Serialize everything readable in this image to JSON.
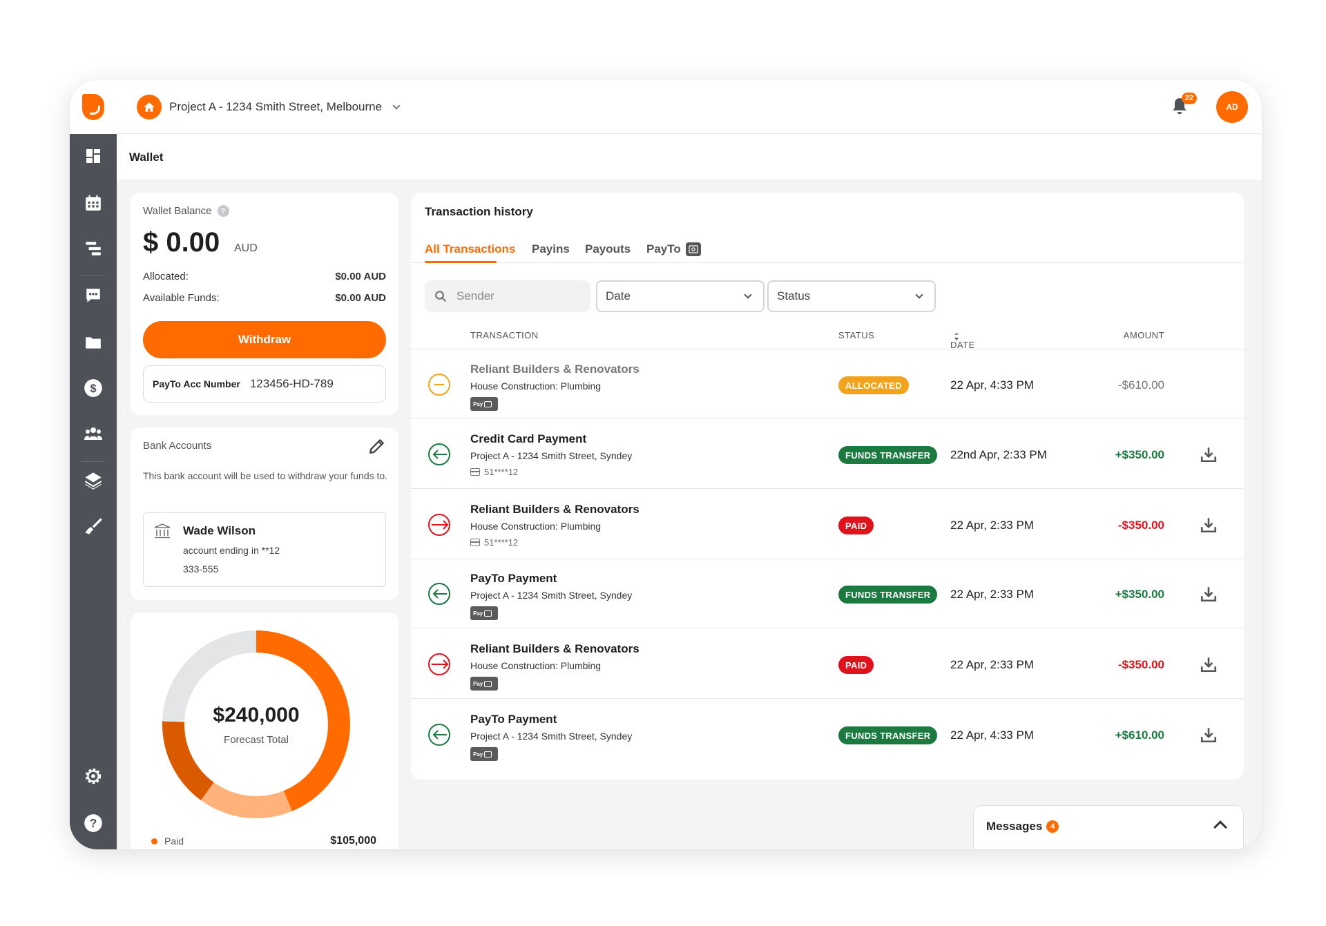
{
  "header": {
    "project_name": "Project A - 1234 Smith Street, Melbourne",
    "notifications_count": "22",
    "avatar_initials": "AD"
  },
  "sidebar": {
    "items": [
      "dashboard-icon",
      "calendar-icon",
      "timeline-icon",
      "chat-icon",
      "folder-icon",
      "dollar-icon",
      "team-icon",
      "layers-icon",
      "brush-icon",
      "settings-icon",
      "help-icon"
    ]
  },
  "page": {
    "title": "Wallet"
  },
  "wallet": {
    "title": "Wallet Balance",
    "help": "?",
    "amount": "$ 0.00",
    "currency": "AUD",
    "allocated_label": "Allocated:",
    "allocated_value": "$0.00 AUD",
    "available_label": "Available Funds:",
    "available_value": "$0.00 AUD",
    "withdraw_label": "Withdraw",
    "payto_label": "PayTo Acc Number",
    "payto_value": "123456-HD-789"
  },
  "bank": {
    "title": "Bank Accounts",
    "description": "This bank account will be used to withdraw your funds to.",
    "account_name": "Wade Wilson",
    "account_line1": "account ending in **12",
    "account_line2": "333-555"
  },
  "forecast": {
    "total": "$240,000",
    "total_label": "Forecast Total",
    "legend_label": "Paid",
    "legend_value": "$105,000",
    "segments": [
      {
        "label": "Paid",
        "fraction": 0.4375,
        "color": "#ff6b00"
      },
      {
        "label": "",
        "fraction": 0.1625,
        "color": "#ffb37a"
      },
      {
        "label": "",
        "fraction": 0.155,
        "color": "#d95a00"
      },
      {
        "label": "",
        "fraction": 0.245,
        "color": "#e4e5e7"
      }
    ]
  },
  "transactions": {
    "title": "Transaction history",
    "tabs": [
      "All Transactions",
      "Payins",
      "Payouts",
      "PayTo"
    ],
    "search_placeholder": "Sender",
    "date_filter": "Date",
    "status_filter": "Status",
    "columns": {
      "transaction": "TRANSACTION",
      "status": "STATUS",
      "date": "DATE",
      "amount": "AMOUNT"
    },
    "rows": [
      {
        "title": "Reliant Builders & Renovators",
        "subtitle": "House Construction: Plumbing",
        "meta": "",
        "status": "ALLOCATED",
        "date": "22 Apr, 4:33 PM",
        "amount": "-$610.00"
      },
      {
        "title": "Credit Card Payment",
        "subtitle": "Project A - 1234 Smith Street, Syndey",
        "meta": "51****12",
        "status": "FUNDS TRANSFER",
        "date": "22nd Apr, 2:33 PM",
        "amount": "+$350.00"
      },
      {
        "title": "Reliant Builders & Renovators",
        "subtitle": "House Construction: Plumbing",
        "meta": "51****12",
        "status": "PAID",
        "date": "22 Apr, 2:33 PM",
        "amount": "-$350.00"
      },
      {
        "title": "PayTo Payment",
        "subtitle": "Project A - 1234 Smith Street, Syndey",
        "meta": "",
        "status": "FUNDS TRANSFER",
        "date": "22 Apr, 2:33 PM",
        "amount": "+$350.00"
      },
      {
        "title": "Reliant Builders & Renovators",
        "subtitle": "House Construction: Plumbing",
        "meta": "",
        "status": "PAID",
        "date": "22 Apr, 2:33 PM",
        "amount": "-$350.00"
      },
      {
        "title": "PayTo Payment",
        "subtitle": "Project A - 1234 Smith Street, Syndey",
        "meta": "",
        "status": "FUNDS TRANSFER",
        "date": "22 Apr, 4:33 PM",
        "amount": "+$610.00"
      }
    ],
    "payto_badge": "Pay"
  },
  "messages": {
    "label": "Messages",
    "count": "4"
  },
  "colors": {
    "accent": "#ff6b00",
    "sidebar": "#4e5258",
    "success": "#1a7a40",
    "danger": "#e0121b",
    "warning": "#f2a31b"
  }
}
